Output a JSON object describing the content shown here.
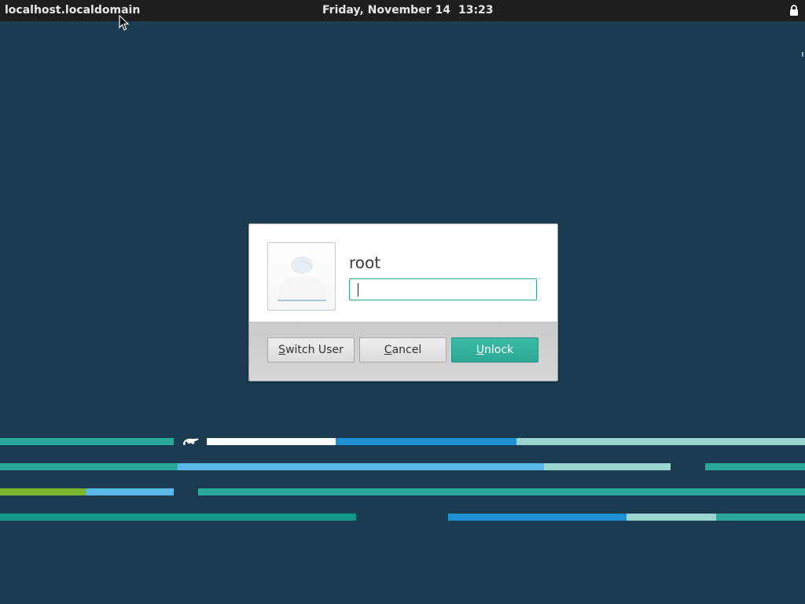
{
  "topbar": {
    "hostname": "localhost.localdomain",
    "date": "Friday, November 14",
    "time": "13:23",
    "lock_icon": "lock-icon"
  },
  "dialog": {
    "username": "root",
    "password_value": "",
    "avatar_icon": "user-avatar-icon",
    "buttons": {
      "switch_user": {
        "mnemonic": "S",
        "rest": "witch User"
      },
      "cancel": {
        "mnemonic": "C",
        "rest": "ancel"
      },
      "unlock": {
        "mnemonic": "U",
        "rest": "nlock"
      }
    }
  },
  "theme": {
    "background": "#1b3c50",
    "accent": "#35a78f",
    "bar_colors": [
      "#2aa99a",
      "#ffffff",
      "#1f90d3",
      "#9bd4d1",
      "#59b8e8",
      "#7cb82f",
      "#0f9a88"
    ]
  }
}
